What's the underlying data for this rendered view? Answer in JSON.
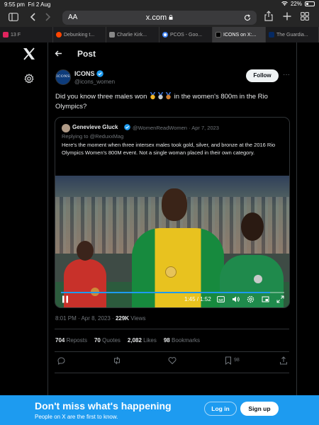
{
  "status_bar": {
    "time": "9:55 pm",
    "date": "Fri 2 Aug",
    "battery": "22%"
  },
  "browser": {
    "aa_label": "AA",
    "url": "x.com",
    "tabs": [
      {
        "label": "13 F",
        "color": "#e0245e",
        "active": false
      },
      {
        "label": "Debunking t...",
        "color": "#ff4500",
        "active": false
      },
      {
        "label": "Charlie Kirk...",
        "color": "#888888",
        "active": false
      },
      {
        "label": "PCOS - Goo...",
        "color": "#4285f4",
        "active": false
      },
      {
        "label": "ICONS on X:...",
        "color": "#000000",
        "active": true
      },
      {
        "label": "The Guardia...",
        "color": "#052962",
        "active": false
      }
    ]
  },
  "header": {
    "title": "Post"
  },
  "post": {
    "avatar_text": "ICONS",
    "author_name": "ICONS",
    "author_handle": "@icons_women",
    "follow_label": "Follow",
    "text_before": "Did you know three males won ",
    "text_after": " in the women's 800m in the Rio Olympics?",
    "timestamp": "8:01 PM · Apr 8, 2023 · ",
    "views_count": "229K",
    "views_label": " Views"
  },
  "quoted": {
    "author_name": "Genevieve Gluck",
    "author_handle": "@WomenReadWomen · Apr 7, 2023",
    "replying_to": "Replying to @ReduxxMag",
    "text": "Here's the moment when three intersex males took gold, silver, and bronze at the 2016 Rio Olympics Women's 800M event. Not a single woman placed in their own category.",
    "video_time": "1:45 / 1:52",
    "video_progress": 0.937
  },
  "stats": {
    "reposts_count": "704",
    "reposts_label": "Reposts",
    "quotes_count": "70",
    "quotes_label": "Quotes",
    "likes_count": "2,082",
    "likes_label": "Likes",
    "bookmarks_count": "98",
    "bookmarks_label": "Bookmarks"
  },
  "actions": {
    "bookmark_count": "98"
  },
  "banner": {
    "title": "Don't miss what's happening",
    "subtitle": "People on X are the first to know.",
    "login_label": "Log in",
    "signup_label": "Sign up"
  },
  "colors": {
    "accent": "#1d9bf0",
    "background": "#000000",
    "border": "#2f3336",
    "muted": "#71767b"
  }
}
